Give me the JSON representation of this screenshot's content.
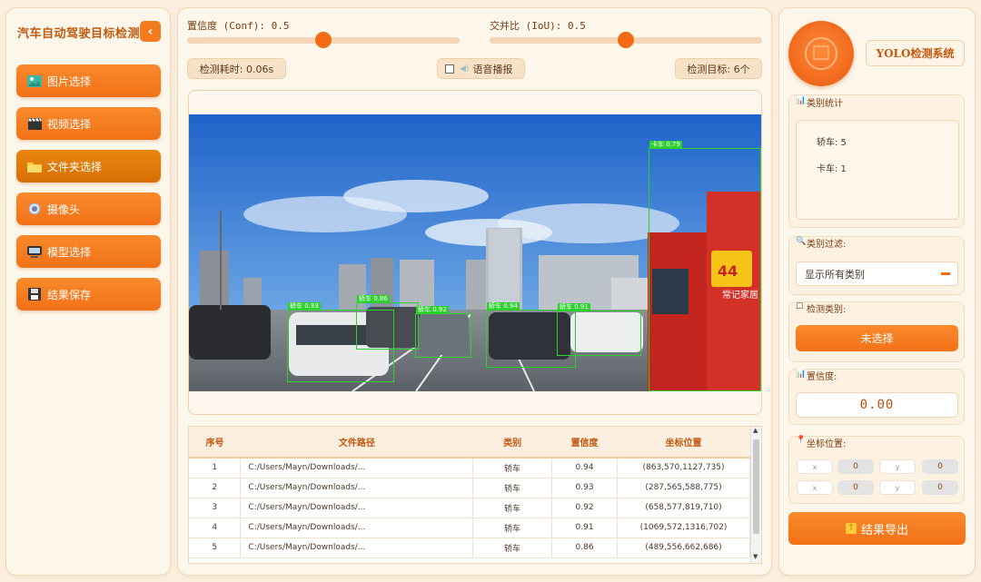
{
  "sidebar": {
    "title": "汽车自动驾驶目标检测",
    "collapse_icon": "chevron-left-icon",
    "buttons": [
      {
        "label": "图片选择",
        "icon": "image-icon"
      },
      {
        "label": "视频选择",
        "icon": "clapperboard-icon"
      },
      {
        "label": "文件夹选择",
        "icon": "folder-icon"
      },
      {
        "label": "摄像头",
        "icon": "camera-icon"
      },
      {
        "label": "模型选择",
        "icon": "computer-icon"
      },
      {
        "label": "结果保存",
        "icon": "floppy-icon"
      }
    ]
  },
  "controls": {
    "conf_label": "置信度 (Conf): 0.5",
    "conf_value": 0.5,
    "iou_label": "交并比 (IoU): 0.5",
    "iou_value": 0.5,
    "time_label": "检测耗时: 0.06s",
    "voice_label": "语音播报",
    "voice_checked": false,
    "count_label": "检测目标: 6个"
  },
  "detections": [
    {
      "label": "卡车 0.79"
    },
    {
      "label": "轿车 0.93"
    },
    {
      "label": "轿车 0.86"
    },
    {
      "label": "轿车 0.92"
    },
    {
      "label": "轿车 0.94"
    },
    {
      "label": "轿车 0.91"
    }
  ],
  "scene_text": {
    "truck_sign": "常记家居",
    "truck_badge": "44"
  },
  "table": {
    "headers": [
      "序号",
      "文件路径",
      "类别",
      "置信度",
      "坐标位置"
    ],
    "rows": [
      [
        "1",
        "C:/Users/Mayn/Downloads/...",
        "轿车",
        "0.94",
        "(863,570,1127,735)"
      ],
      [
        "2",
        "C:/Users/Mayn/Downloads/...",
        "轿车",
        "0.93",
        "(287,565,588,775)"
      ],
      [
        "3",
        "C:/Users/Mayn/Downloads/...",
        "轿车",
        "0.92",
        "(658,577,819,710)"
      ],
      [
        "4",
        "C:/Users/Mayn/Downloads/...",
        "轿车",
        "0.91",
        "(1069,572,1316,702)"
      ],
      [
        "5",
        "C:/Users/Mayn/Downloads/...",
        "轿车",
        "0.86",
        "(489,556,662,686)"
      ]
    ]
  },
  "right": {
    "system_title": "YOLO检测系统",
    "stats_title": "类别统计",
    "stats": [
      "轿车: 5",
      "卡车: 1"
    ],
    "filter_title": "类别过滤:",
    "filter_value": "显示所有类别",
    "detect_title": "检测类别:",
    "detect_button": "未选择",
    "conf_title": "置信度:",
    "conf_value": "0.00",
    "coord_title": "坐标位置:",
    "coords": [
      {
        "label": "x",
        "value": "0"
      },
      {
        "label": "y",
        "value": "0"
      },
      {
        "label": "x",
        "value": "0"
      },
      {
        "label": "y",
        "value": "0"
      }
    ],
    "export_button": "结果导出"
  },
  "colors": {
    "accent": "#f27117",
    "box": "#2dd12d",
    "background": "#fbeede"
  }
}
